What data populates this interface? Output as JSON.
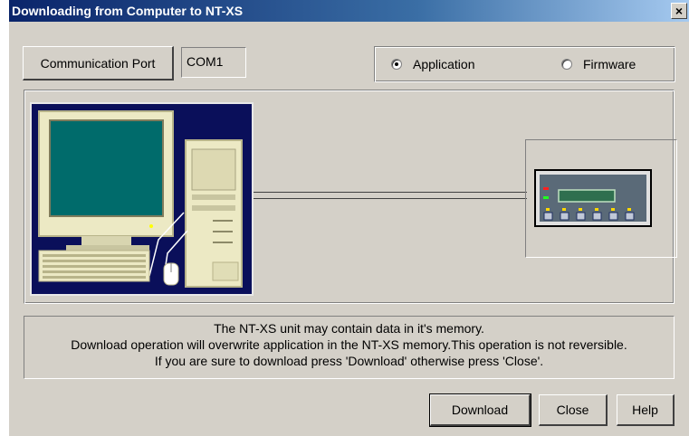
{
  "window": {
    "title": "Downloading from Computer to NT-XS",
    "close_glyph": "×"
  },
  "port": {
    "button_label": "Communication Port",
    "value": "COM1"
  },
  "download_type": {
    "options": [
      {
        "label": "Application",
        "selected": true
      },
      {
        "label": "Firmware",
        "selected": false
      }
    ]
  },
  "message": {
    "lines": [
      "The NT-XS unit may contain data in it's memory.",
      "Download operation will overwrite application in the NT-XS memory.This operation is not reversible.",
      "If you are sure to download press 'Download' otherwise press 'Close'."
    ]
  },
  "buttons": {
    "download": "Download",
    "close": "Close",
    "help": "Help"
  },
  "icons": {
    "computer": "desktop-computer-icon",
    "device": "nt-xs-device-icon"
  },
  "colors": {
    "titlebar_start": "#0a246a",
    "panel_bg": "#0a0f5a",
    "screen": "#006b6b",
    "dialog_face": "#d4d0c8"
  }
}
